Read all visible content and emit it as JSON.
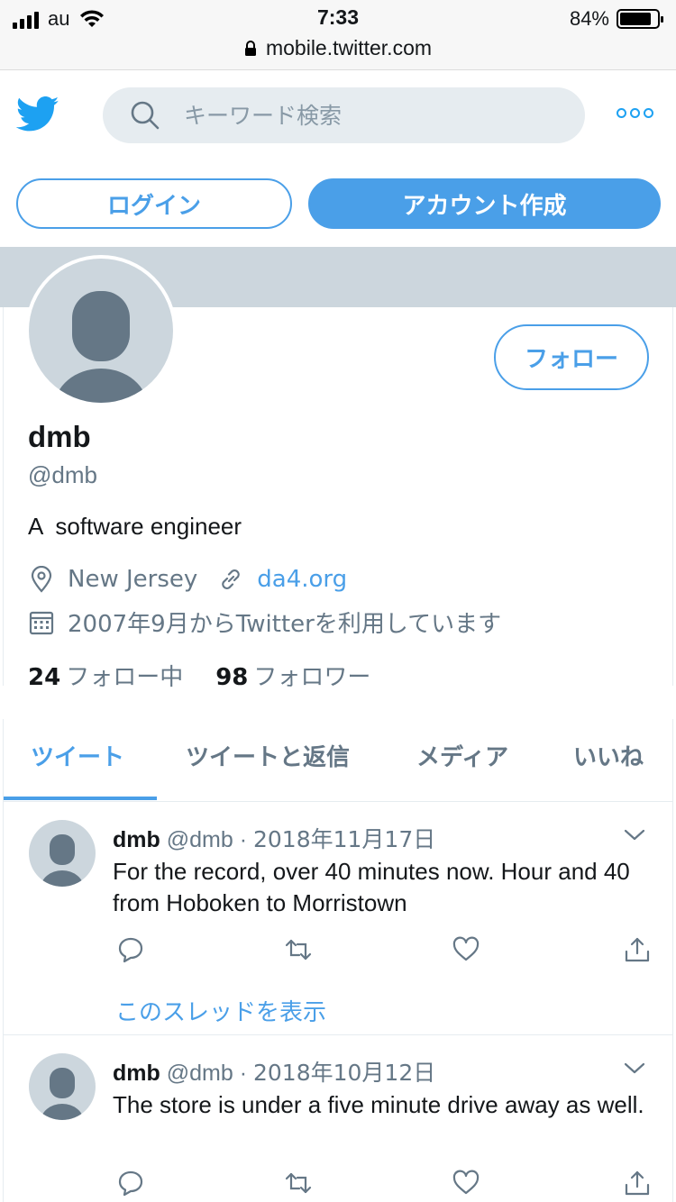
{
  "status_bar": {
    "carrier": "au",
    "time": "7:33",
    "battery_percent": "84%",
    "battery_level": 0.84,
    "url": "mobile.twitter.com"
  },
  "header": {
    "search_placeholder": "キーワード検索",
    "login_label": "ログイン",
    "signup_label": "アカウント作成"
  },
  "profile": {
    "follow_label": "フォロー",
    "name": "dmb",
    "handle": "@dmb",
    "bio": "A  software engineer",
    "location": "New Jersey",
    "website": "da4.org",
    "joined": "2007年9月からTwitterを利用しています",
    "following_count": "24",
    "following_label": "フォロー中",
    "followers_count": "98",
    "followers_label": "フォロワー"
  },
  "tabs": [
    {
      "label": "ツイート"
    },
    {
      "label": "ツイートと返信"
    },
    {
      "label": "メディア"
    },
    {
      "label": "いいね"
    }
  ],
  "tweets": [
    {
      "name": "dmb",
      "handle": "@dmb",
      "separator": "·",
      "date": "2018年11月17日",
      "text": "For the record, over 40 minutes now. Hour and 40 from Hoboken to Morristown",
      "thread_link": "このスレッドを表示"
    },
    {
      "name": "dmb",
      "handle": "@dmb",
      "separator": "·",
      "date": "2018年10月12日",
      "text": "The store is under a five minute drive away as well."
    }
  ],
  "colors": {
    "accent": "#4a9fe8",
    "twitter_blue": "#1da1f2",
    "banner": "#ccd6dd",
    "muted_text": "#657786"
  }
}
